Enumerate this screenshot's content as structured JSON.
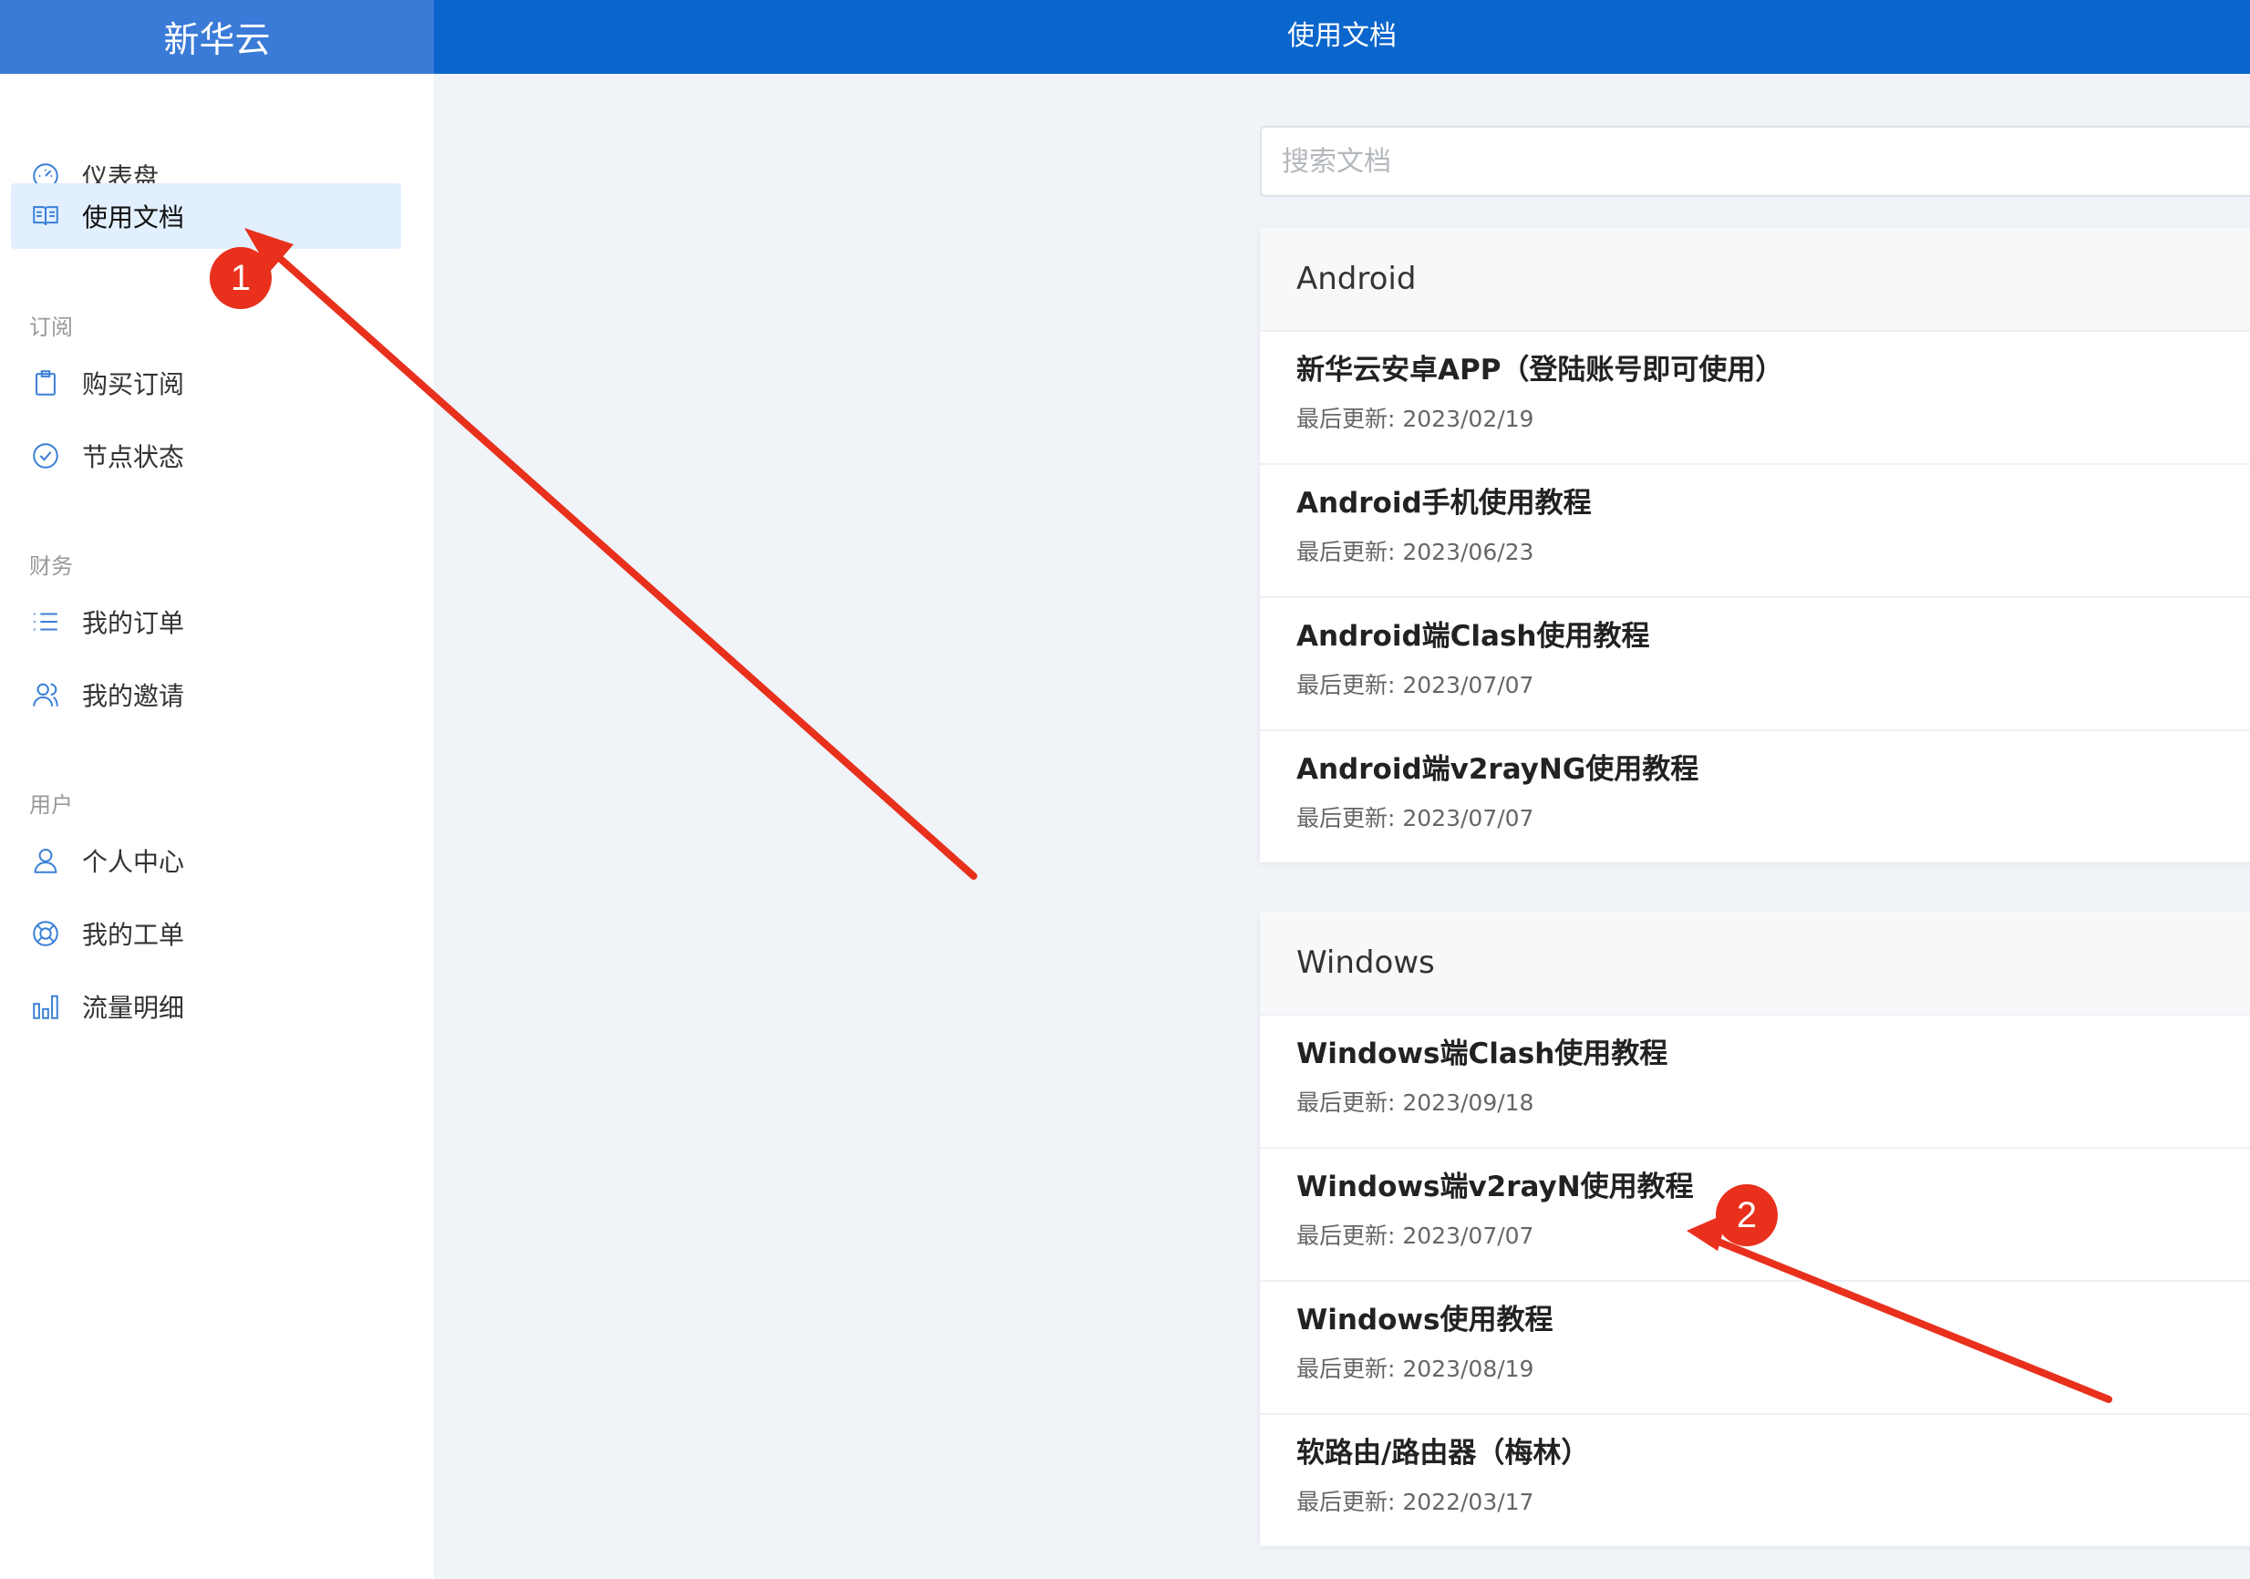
{
  "app": {
    "brand": "新华云",
    "page_title": "使用文档"
  },
  "sidebar": {
    "items": [
      {
        "label": "仪表盘",
        "icon": "dashboard-icon"
      },
      {
        "label": "使用文档",
        "icon": "book-icon",
        "active": true
      },
      {
        "label": "购买订阅",
        "icon": "clipboard-icon"
      },
      {
        "label": "节点状态",
        "icon": "check-circle-icon"
      },
      {
        "label": "我的订单",
        "icon": "list-icon"
      },
      {
        "label": "我的邀请",
        "icon": "users-icon"
      },
      {
        "label": "个人中心",
        "icon": "user-icon"
      },
      {
        "label": "我的工单",
        "icon": "lifebuoy-icon"
      },
      {
        "label": "流量明细",
        "icon": "bar-chart-icon"
      }
    ],
    "sections": {
      "subscribe": "订阅",
      "finance": "财务",
      "user": "用户"
    }
  },
  "search": {
    "placeholder": "搜索文档",
    "value": ""
  },
  "groups": [
    {
      "title": "Android",
      "docs": [
        {
          "title": "新华云安卓APP（登陆账号即可使用）",
          "updated": "最后更新: 2023/02/19"
        },
        {
          "title": "Android手机使用教程",
          "updated": "最后更新: 2023/06/23"
        },
        {
          "title": "Android端Clash使用教程",
          "updated": "最后更新: 2023/07/07"
        },
        {
          "title": "Android端v2rayNG使用教程",
          "updated": "最后更新: 2023/07/07"
        }
      ]
    },
    {
      "title": "Windows",
      "docs": [
        {
          "title": "Windows端Clash使用教程",
          "updated": "最后更新: 2023/09/18"
        },
        {
          "title": "Windows端v2rayN使用教程",
          "updated": "最后更新: 2023/07/07"
        },
        {
          "title": "Windows使用教程",
          "updated": "最后更新: 2023/08/19"
        },
        {
          "title": "软路由/路由器（梅林）",
          "updated": "最后更新: 2022/03/17"
        }
      ]
    }
  ],
  "annotations": {
    "marker_1": "1",
    "marker_2": "2"
  },
  "colors": {
    "header_brand": "#3b7bd8",
    "header": "#0a66cc",
    "accent": "#3a7fd6",
    "active_bg": "#e2efff",
    "annotation": "#e8301c"
  }
}
